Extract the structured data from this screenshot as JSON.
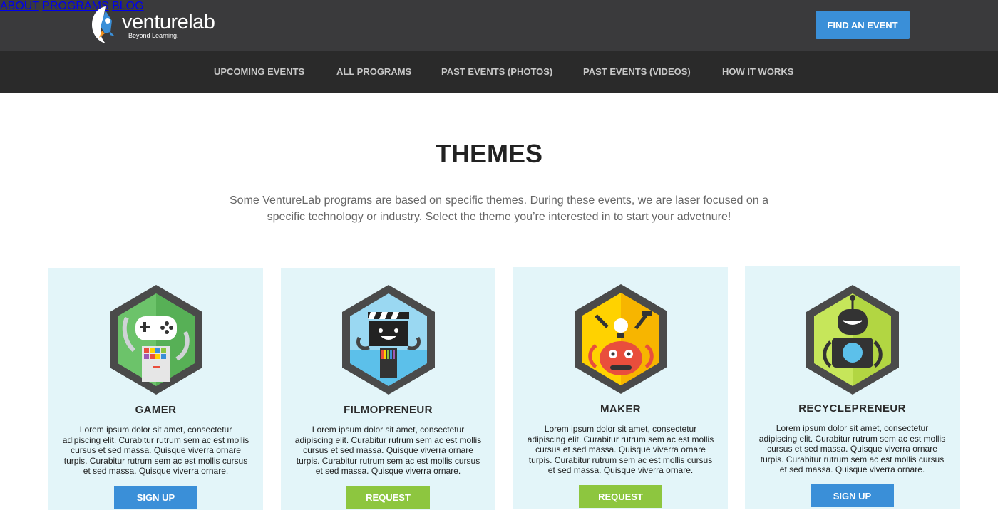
{
  "brand": {
    "name_a": "venture",
    "name_b": "lab",
    "tagline": "Beyond Learning."
  },
  "topnav": {
    "about": "ABOUT",
    "programs": "PROGRAMS",
    "blog": "BLOG",
    "find_event": "FIND AN EVENT"
  },
  "subnav": {
    "upcoming": "UPCOMING EVENTS",
    "all_programs": "ALL PROGRAMS",
    "past_photos": "PAST EVENTS (PHOTOS)",
    "past_videos": "PAST EVENTS (VIDEOS)",
    "how_it_works": "HOW IT WORKS"
  },
  "page": {
    "heading": "THEMES",
    "intro": "Some VentureLab programs are based on specific themes. During these events, we are laser focused on a specific technology or industry. Select the theme you’re interested in to start your advetnure!"
  },
  "themes": [
    {
      "title": "GAMER",
      "desc": "Lorem ipsum dolor sit amet, consectetur adipiscing elit. Curabitur rutrum sem ac est mollis cursus et sed massa. Quisque viverra ornare turpis. Curabitur rutrum sem ac est mollis cursus et sed massa. Quisque viverra ornare.",
      "button": "SIGN UP",
      "button_color": "#3a8fd8",
      "badge_color": "#6cc36a",
      "icon": "gamepad-robot-icon"
    },
    {
      "title": "FILMOPRENEUR",
      "desc": "Lorem ipsum dolor sit amet, consectetur adipiscing elit. Curabitur rutrum sem ac est mollis cursus et sed massa. Quisque viverra ornare turpis. Curabitur rutrum sem ac est mollis cursus et sed massa. Quisque viverra ornare.",
      "button": "REQUEST",
      "button_color": "#8dc63f",
      "badge_color": "#7fcff0",
      "icon": "clapperboard-robot-icon"
    },
    {
      "title": "MAKER",
      "desc": "Lorem ipsum dolor sit amet, consectetur adipiscing elit. Curabitur rutrum sem ac est mollis cursus et sed massa. Quisque viverra ornare turpis. Curabitur rutrum sem ac est mollis cursus et sed massa. Quisque viverra ornare.",
      "button": "REQUEST",
      "button_color": "#8dc63f",
      "badge_color": "#ffd200",
      "icon": "tools-robot-icon"
    },
    {
      "title": "RECYCLEPRENEUR",
      "desc": "Lorem ipsum dolor sit amet, consectetur adipiscing elit. Curabitur rutrum sem ac est mollis cursus et sed massa. Quisque viverra ornare turpis. Curabitur rutrum sem ac est mollis cursus et sed massa. Quisque viverra ornare.",
      "button": "SIGN UP",
      "button_color": "#3a8fd8",
      "badge_color": "#c6e65a",
      "icon": "globe-robot-icon"
    }
  ]
}
